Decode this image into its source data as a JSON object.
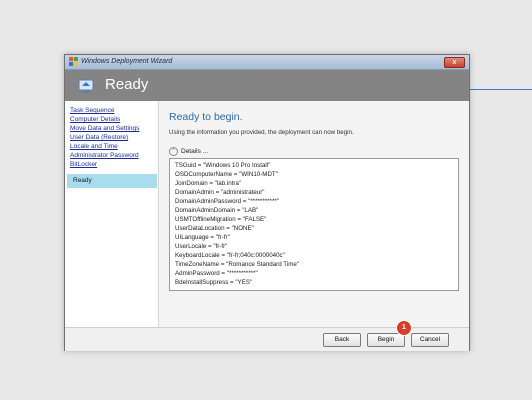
{
  "window": {
    "title": "Windows Deployment Wizard",
    "close_label": "x"
  },
  "header": {
    "title": "Ready"
  },
  "sidebar": {
    "items": [
      {
        "label": "Task Sequence"
      },
      {
        "label": "Computer Details"
      },
      {
        "label": "Move Data and Settings"
      },
      {
        "label": "User Data (Restore)"
      },
      {
        "label": "Locale and Time"
      },
      {
        "label": "Administrator Password"
      },
      {
        "label": "BitLocker"
      }
    ],
    "active_label": "Ready"
  },
  "main": {
    "heading": "Ready to begin.",
    "subtitle": "Using the information you provided, the deployment can now begin.",
    "details_label": "Details ...",
    "details_toggle_icon": "chevron-up-icon",
    "details": [
      "TSGuid = \"Windows 10 Pro Install\"",
      "OSDComputerName = \"WIN10-MDT\"",
      "JoinDomain = \"lab.intra\"",
      "DomainAdmin = \"administrateur\"",
      "DomainAdminPassword = \"***********\"",
      "DomainAdminDomain = \"LAB\"",
      "USMTOfflineMigration = \"FALSE\"",
      "UserDataLocation = \"NONE\"",
      "UILanguage = \"fr-fr\"",
      "UserLocale = \"fr-fr\"",
      "KeyboardLocale = \"fr-fr;040c:0000040c\"",
      "TimeZoneName = \"Romance Standard Time\"",
      "AdminPassword = \"***********\"",
      "BdeInstallSuppress = \"YES\""
    ]
  },
  "footer": {
    "back_label": "Back",
    "begin_label": "Begin",
    "cancel_label": "Cancel"
  },
  "badge": {
    "text": "1",
    "color": "#d93e2b"
  },
  "colors": {
    "header_bg": "#848484",
    "active_nav_bg": "#a8dcef",
    "link": "#1a2b99",
    "heading": "#2b6aa8"
  }
}
